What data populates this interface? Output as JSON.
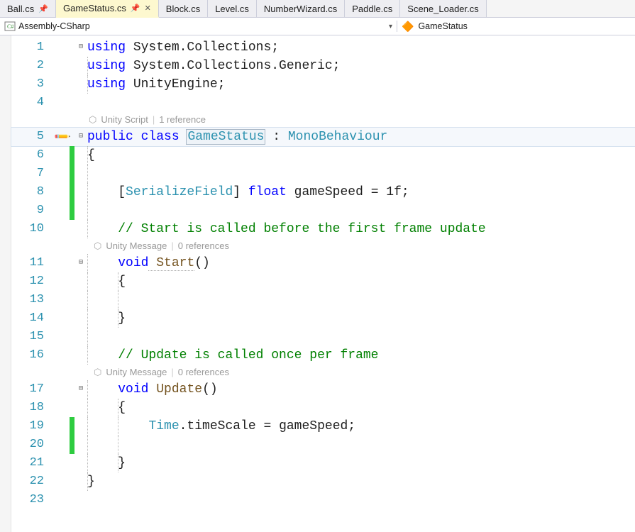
{
  "tabs": [
    {
      "label": "Ball.cs",
      "pinned": true,
      "active": false
    },
    {
      "label": "GameStatus.cs",
      "pinned": true,
      "active": true,
      "closeable": true
    },
    {
      "label": "Block.cs",
      "active": false
    },
    {
      "label": "Level.cs",
      "active": false
    },
    {
      "label": "NumberWizard.cs",
      "active": false
    },
    {
      "label": "Paddle.cs",
      "active": false
    },
    {
      "label": "Scene_Loader.cs",
      "active": false
    }
  ],
  "nav": {
    "project": "Assembly-CSharp",
    "class": "GameStatus"
  },
  "codelens": {
    "class_lens": {
      "left": "Unity Script",
      "right": "1 reference"
    },
    "start_lens": {
      "left": "Unity Message",
      "right": "0 references"
    },
    "update_lens": {
      "left": "Unity Message",
      "right": "0 references"
    }
  },
  "code": {
    "l1_kw": "using",
    "l1_ns": " System.Collections;",
    "l2_kw": "using",
    "l2_ns": " System.Collections.Generic;",
    "l3_kw": "using",
    "l3_ns": " UnityEngine;",
    "l5_pub": "public",
    "l5_class": " class ",
    "l5_name": "GameStatus",
    "l5_colon": " : ",
    "l5_base": "MonoBehaviour",
    "l6_brace": "{",
    "l8_attr": "SerializeField",
    "l8_kw": " float",
    "l8_rest": " gameSpeed = 1f;",
    "l10_c": "// Start is called before the first frame update",
    "l11_kw": "void",
    "l11_name": " Start",
    "l11_paren": "()",
    "l12_brace": "{",
    "l14_brace": "}",
    "l16_c": "// Update is called once per frame",
    "l17_kw": "void",
    "l17_name": " Update",
    "l17_paren": "()",
    "l18_brace": "{",
    "l19_time": "Time",
    "l19_rest": ".timeScale = gameSpeed;",
    "l21_brace": "}",
    "l22_brace": "}"
  },
  "line_numbers": [
    "1",
    "2",
    "3",
    "4",
    "5",
    "6",
    "7",
    "8",
    "9",
    "10",
    "11",
    "12",
    "13",
    "14",
    "15",
    "16",
    "17",
    "18",
    "19",
    "20",
    "21",
    "22",
    "23"
  ]
}
